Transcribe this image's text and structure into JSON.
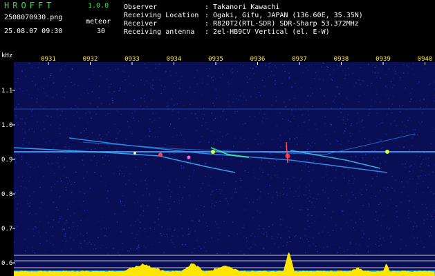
{
  "header": {
    "app_name": "HROFFT",
    "version": "1.0.0",
    "filename": "2508070930.png",
    "datetime": "25.08.07 09:30",
    "meteor_label": "meteor",
    "meteor_count": "30",
    "fields": [
      {
        "key": "Observer",
        "value": ": Takanori Kawachi"
      },
      {
        "key": "Receiving Location",
        "value": ": Ogaki, Gifu, JAPAN (136.60E, 35.35N)"
      },
      {
        "key": "Receiver",
        "value": ": R820T2(RTL-SDR) SDR-Sharp 53.372MHz"
      },
      {
        "key": "Receiving antenna",
        "value": ": 2el-HB9CV Vertical (el. E-W)"
      }
    ]
  },
  "spectrogram": {
    "y_unit": "kHz",
    "y_ticks": [
      "1.1",
      "1.0",
      "0.9",
      "0.8",
      "0.7",
      "0.6"
    ],
    "x_ticks": [
      "0931",
      "0932",
      "0933",
      "0934",
      "0935",
      "0936",
      "0937",
      "0938",
      "0939",
      "0940"
    ],
    "colors": {
      "background": "#0a0f55",
      "carrier": "#3aa0ff",
      "grid_line": "#c8c8c8",
      "level": "#ffe600",
      "level_base": "#20b0ff",
      "tick_text": "#ffe34a"
    }
  }
}
